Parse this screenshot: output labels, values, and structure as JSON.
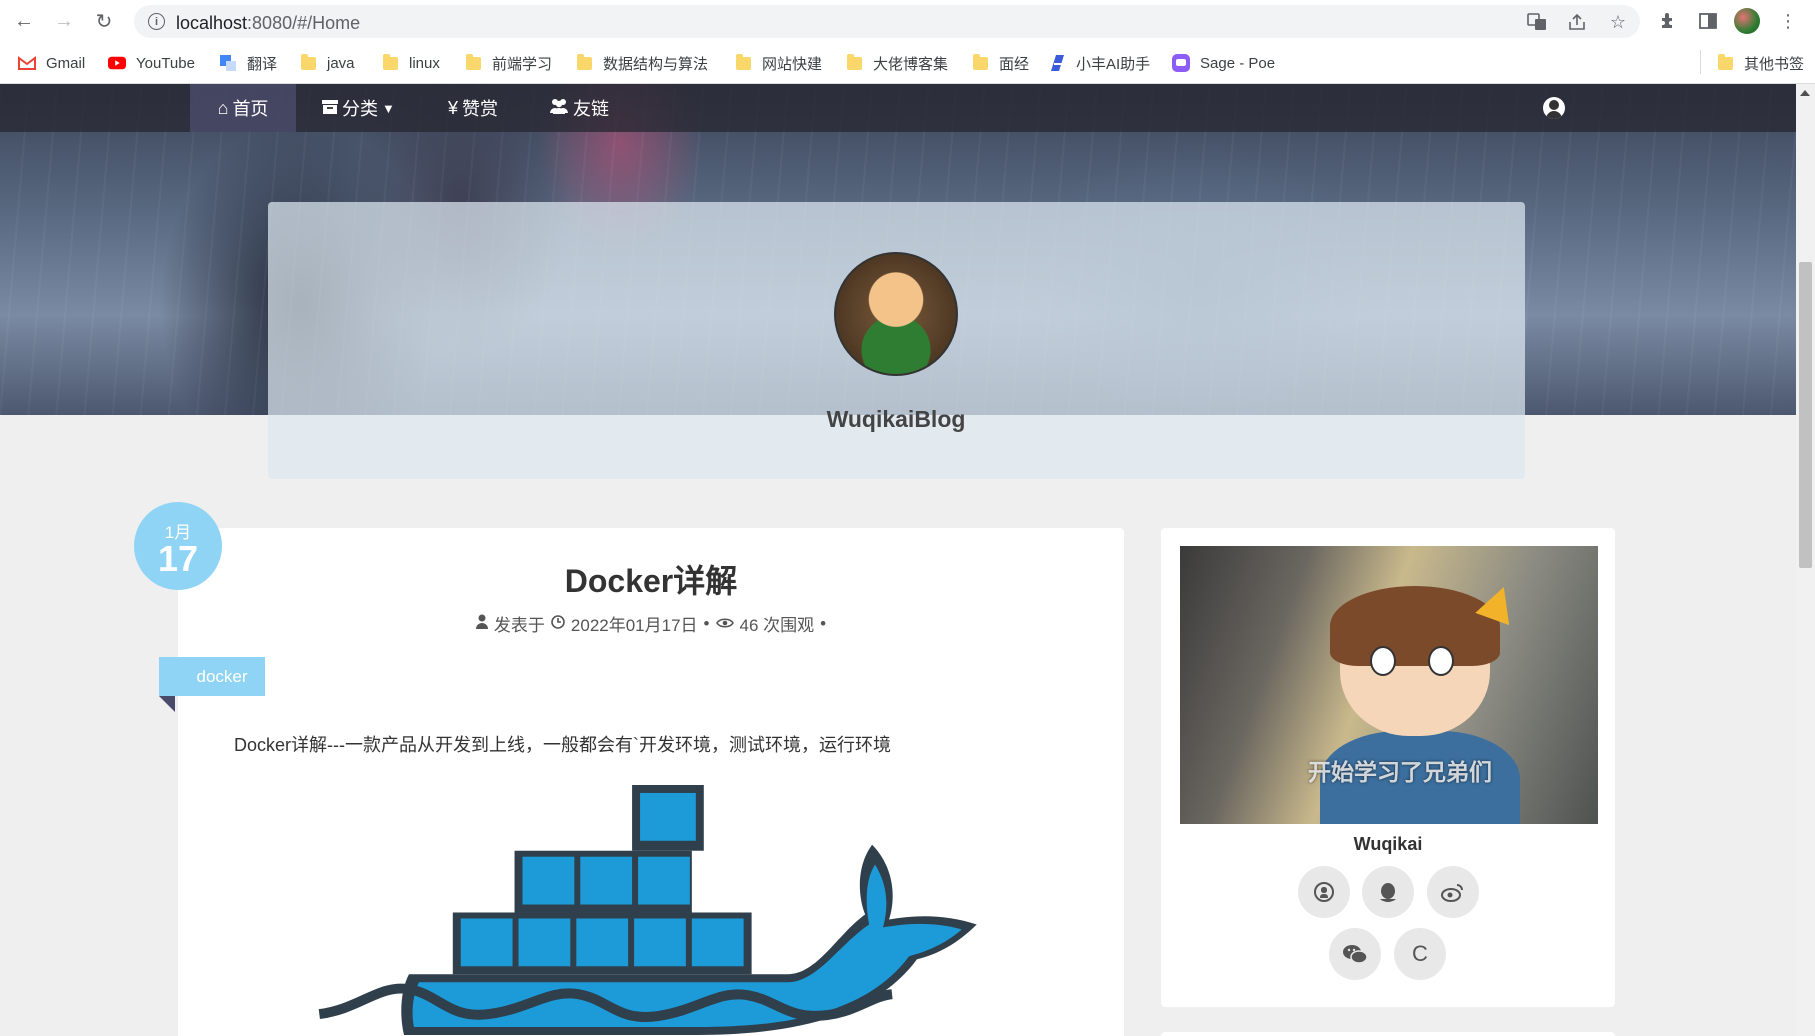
{
  "browser": {
    "url_host": "localhost",
    "url_rest": ":8080/#/Home",
    "bookmarks": [
      {
        "label": "Gmail",
        "icon": "gmail-icon"
      },
      {
        "label": "YouTube",
        "icon": "youtube-icon"
      },
      {
        "label": "翻译",
        "icon": "translate-icon"
      },
      {
        "label": "java",
        "icon": "folder-icon"
      },
      {
        "label": "linux",
        "icon": "folder-icon"
      },
      {
        "label": "前端学习",
        "icon": "folder-icon"
      },
      {
        "label": "数据结构与算法",
        "icon": "folder-icon"
      },
      {
        "label": "网站快建",
        "icon": "folder-icon"
      },
      {
        "label": "大佬博客集",
        "icon": "folder-icon"
      },
      {
        "label": "面经",
        "icon": "folder-icon"
      },
      {
        "label": "小丰AI助手",
        "icon": "ai-icon"
      },
      {
        "label": "Sage - Poe",
        "icon": "poe-icon"
      }
    ],
    "other_bookmarks": "其他书签"
  },
  "nav": {
    "home": "首页",
    "category": "分类",
    "reward": "赞赏",
    "friends": "友链",
    "reward_symbol": "¥"
  },
  "profile": {
    "blog_name": "WuqikaiBlog"
  },
  "post": {
    "month": "1月",
    "day": "17",
    "title": "Docker详解",
    "meta_prefix": "发表于",
    "date": "2022年01月17日",
    "views": "46 次围观",
    "tag": "docker",
    "excerpt": "Docker详解---一款产品从开发到上线，一般都会有`开发环境，测试环境，运行环境"
  },
  "sidebar": {
    "image_caption": "开始学习了兄弟们",
    "name": "Wuqikai",
    "csdn_letter": "C"
  },
  "colors": {
    "accent": "#8fd4f5",
    "docker_blue": "#1d9ad8",
    "docker_dark": "#2f3f4b"
  }
}
